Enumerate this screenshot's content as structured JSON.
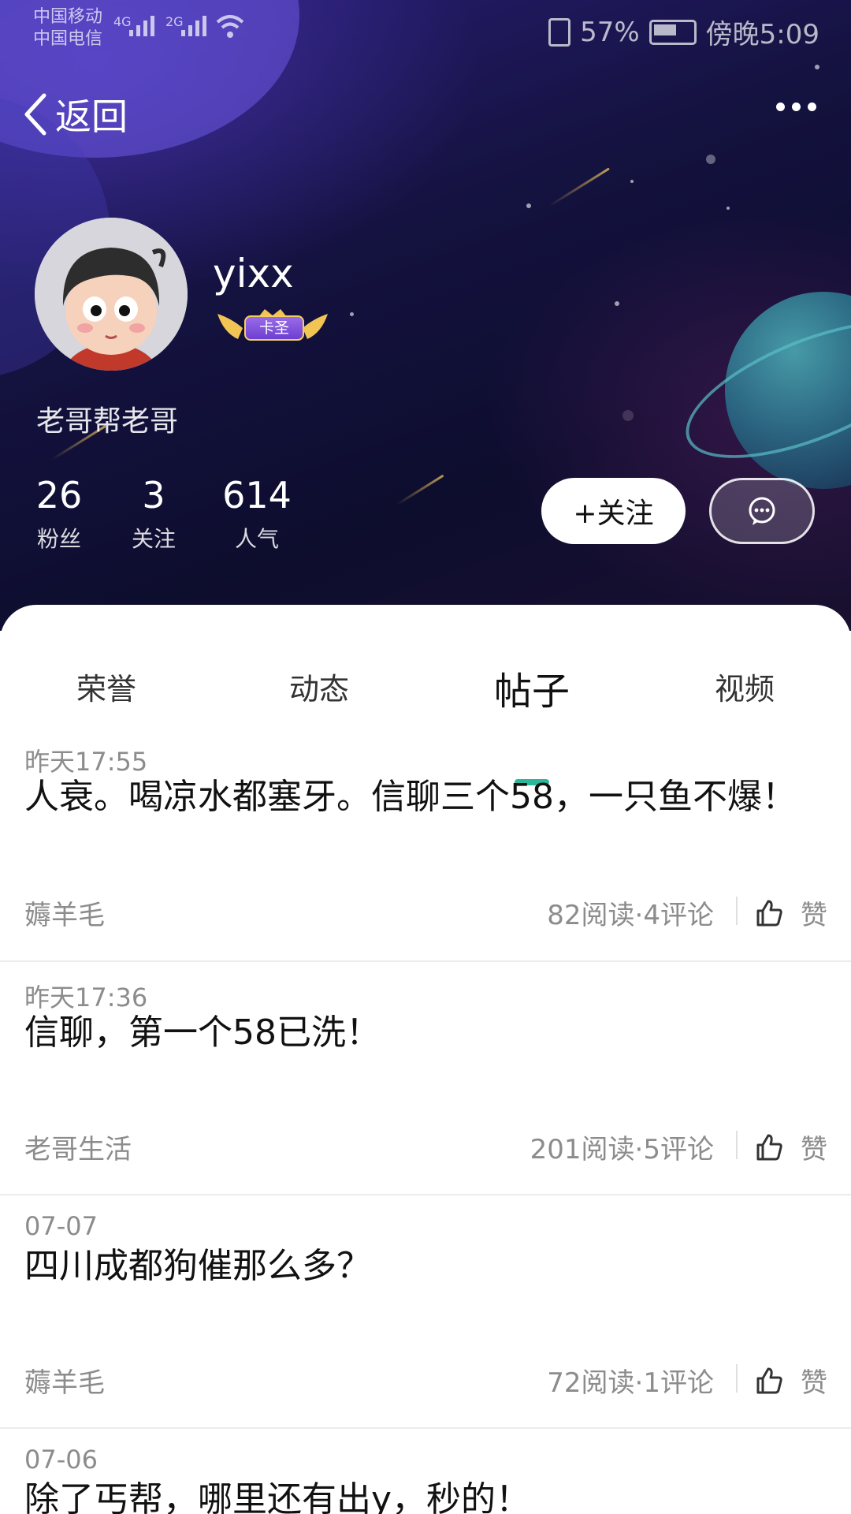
{
  "status_bar": {
    "carrier_1": "中国移动",
    "carrier_2": "中国电信",
    "net_1": "4G",
    "net_2": "2G",
    "battery": "57%",
    "time": "傍晚5:09"
  },
  "nav": {
    "back_label": "返回"
  },
  "profile": {
    "username": "yixx",
    "badge_label": "卡圣",
    "bio": "老哥帮老哥",
    "stats": [
      {
        "value": "26",
        "label": "粉丝"
      },
      {
        "value": "3",
        "label": "关注"
      },
      {
        "value": "614",
        "label": "人气"
      }
    ],
    "follow_label": "+关注"
  },
  "tabs": [
    {
      "label": "荣誉"
    },
    {
      "label": "动态"
    },
    {
      "label": "帖子"
    },
    {
      "label": "视频"
    }
  ],
  "active_tab": "帖子",
  "accent_color": "#2bb89a",
  "posts": [
    {
      "time": "昨天17:55",
      "title": "人衰。喝凉水都塞牙。信聊三个58，一只鱼不爆！",
      "group": "薅羊毛",
      "meta": "82阅读·4评论",
      "like_label": "赞"
    },
    {
      "time": "昨天17:36",
      "title": "信聊，第一个58已洗！",
      "group": "老哥生活",
      "meta": "201阅读·5评论",
      "like_label": "赞"
    },
    {
      "time": "07-07",
      "title": "四川成都狗催那么多？",
      "group": "薅羊毛",
      "meta": "72阅读·1评论",
      "like_label": "赞"
    },
    {
      "time": "07-06",
      "title": "除了丐帮，哪里还有出y，秒的！"
    }
  ]
}
